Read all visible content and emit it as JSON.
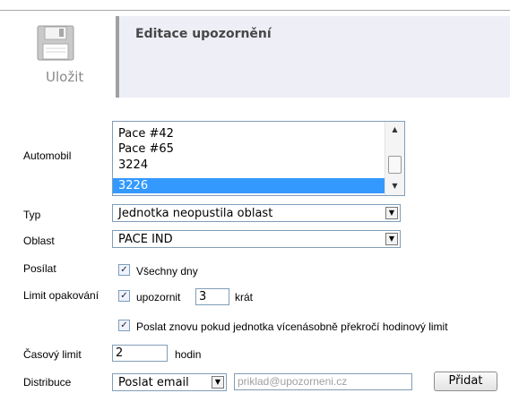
{
  "toolbar": {
    "save_label": "Uložit",
    "save_icon": "floppy-disk-icon"
  },
  "header": {
    "title": "Editace upozornění"
  },
  "form": {
    "automobil": {
      "label": "Automobil",
      "items": [
        "Pace #42",
        "Pace #65",
        "3224",
        "3226"
      ],
      "selected": "3226"
    },
    "typ": {
      "label": "Typ",
      "value": "Jednotka neopustila oblast"
    },
    "oblast": {
      "label": "Oblast",
      "value": "PACE IND"
    },
    "poslat": {
      "label": "Posílat",
      "checkbox_label": "Všechny dny",
      "checked": true
    },
    "limit_opakovani": {
      "label": "Limit opakování",
      "checkbox_label": "upozornit",
      "value": "3",
      "suffix": "krát",
      "checked": true
    },
    "poslat_znovu": {
      "checkbox_label": "Poslat znovu pokud jednotka vícenásobně překročí hodinový limit",
      "checked": true
    },
    "casovy_limit": {
      "label": "Časový limit",
      "value": "2",
      "suffix": "hodin"
    },
    "distribuce": {
      "label": "Distribuce",
      "method": "Poslat email",
      "placeholder": "priklad@upozorneni.cz",
      "add_label": "Přidat"
    }
  }
}
